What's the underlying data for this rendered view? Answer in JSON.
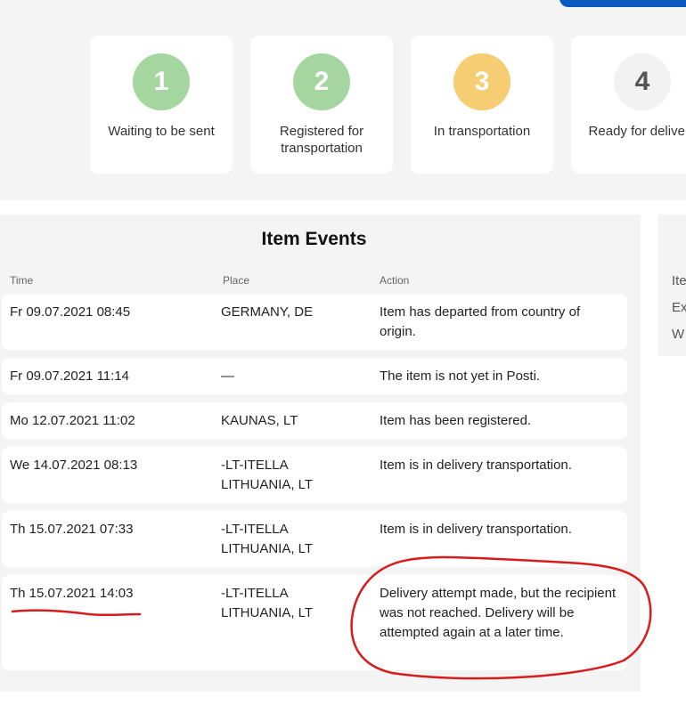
{
  "steps": [
    {
      "number": "1",
      "label": "Waiting to be sent",
      "color": "#a5d6a0"
    },
    {
      "number": "2",
      "label": "Registered for transportation",
      "color": "#a5d6a0"
    },
    {
      "number": "3",
      "label": "In transportation",
      "color": "#f7cd73"
    },
    {
      "number": "4",
      "label": "Ready for delivery",
      "color": "#f2f2f2"
    }
  ],
  "events": {
    "title": "Item Events",
    "columns": {
      "time": "Time",
      "place": "Place",
      "action": "Action"
    },
    "rows": [
      {
        "time": "Fr 09.07.2021 08:45",
        "place": "GERMANY, DE",
        "action": "Item has departed from country of origin."
      },
      {
        "time": "Fr 09.07.2021 11:14",
        "place": "—",
        "action": "The item is not yet in Posti."
      },
      {
        "time": "Mo 12.07.2021 11:02",
        "place": "KAUNAS, LT",
        "action": "Item has been registered."
      },
      {
        "time": "We 14.07.2021 08:13",
        "place": "-LT-ITELLA LITHUANIA, LT",
        "action": "Item is in delivery transportation."
      },
      {
        "time": "Th 15.07.2021 07:33",
        "place": "-LT-ITELLA LITHUANIA, LT",
        "action": "Item is in delivery transportation."
      },
      {
        "time": "Th 15.07.2021 14:03",
        "place": "-LT-ITELLA LITHUANIA, LT",
        "action": "Delivery attempt made, but the recipient was not reached. Delivery will be attempted again at a later time."
      }
    ]
  },
  "side_panel": {
    "lines": [
      "Ite",
      "Ex",
      "W"
    ]
  },
  "colors": {
    "accent_blue": "#0a5bc1",
    "annotation_red": "#d81b1b"
  }
}
